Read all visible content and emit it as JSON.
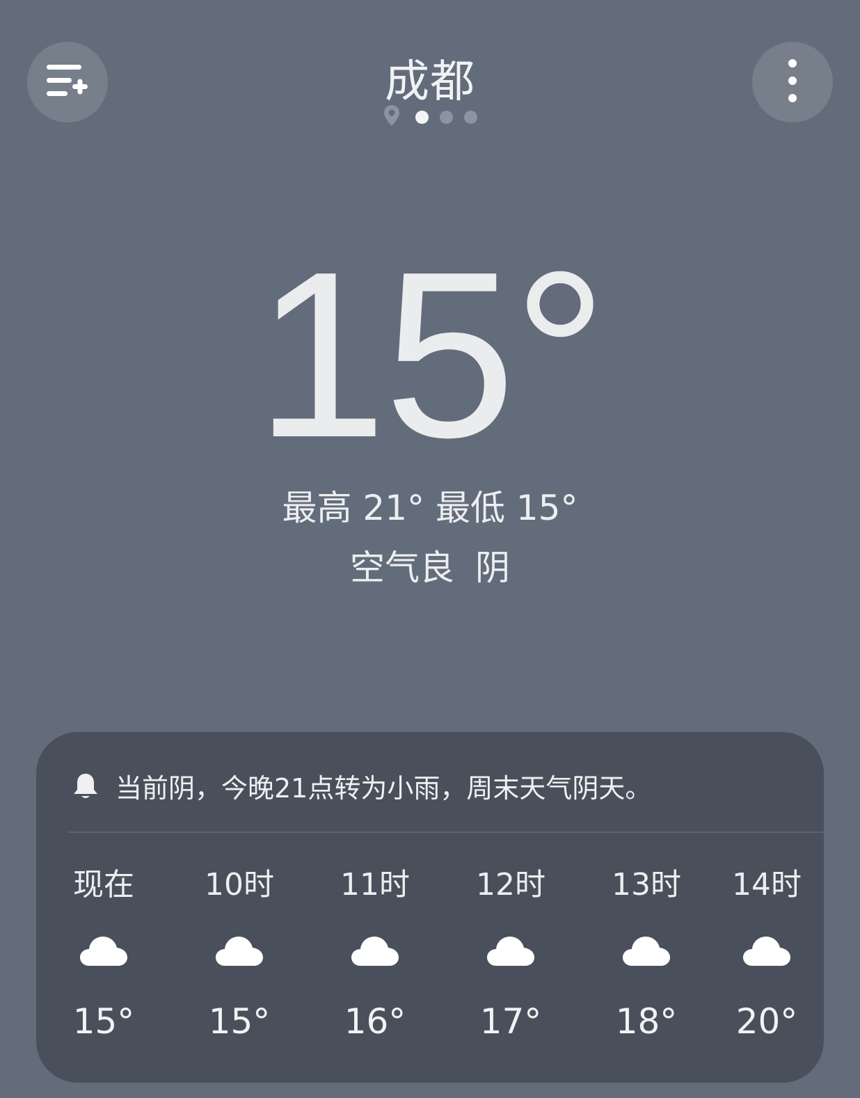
{
  "header": {
    "city": "成都",
    "menu_icon": "list-add-icon",
    "more_icon": "more-vertical-icon",
    "location_icon": "location-pin-icon",
    "pages": [
      {
        "active": true
      },
      {
        "active": false
      },
      {
        "active": false
      }
    ]
  },
  "current": {
    "temperature": "15°",
    "high_low": "最高 21° 最低 15°",
    "air_quality": "空气良",
    "condition": "阴"
  },
  "forecast": {
    "alert_icon": "bell-icon",
    "alert_text": "当前阴，今晚21点转为小雨，周末天气阴天。",
    "hourly": [
      {
        "label": "现在",
        "icon": "cloud-icon",
        "temp": "15°"
      },
      {
        "label": "10时",
        "icon": "cloud-icon",
        "temp": "15°"
      },
      {
        "label": "11时",
        "icon": "cloud-icon",
        "temp": "16°"
      },
      {
        "label": "12时",
        "icon": "cloud-icon",
        "temp": "17°"
      },
      {
        "label": "13时",
        "icon": "cloud-icon",
        "temp": "18°"
      },
      {
        "label": "14时",
        "icon": "cloud-icon",
        "temp": "20°"
      }
    ]
  },
  "colors": {
    "background": "#636c7a",
    "card": "#4a505b",
    "button": "#777f8b",
    "text": "#eceef0"
  }
}
